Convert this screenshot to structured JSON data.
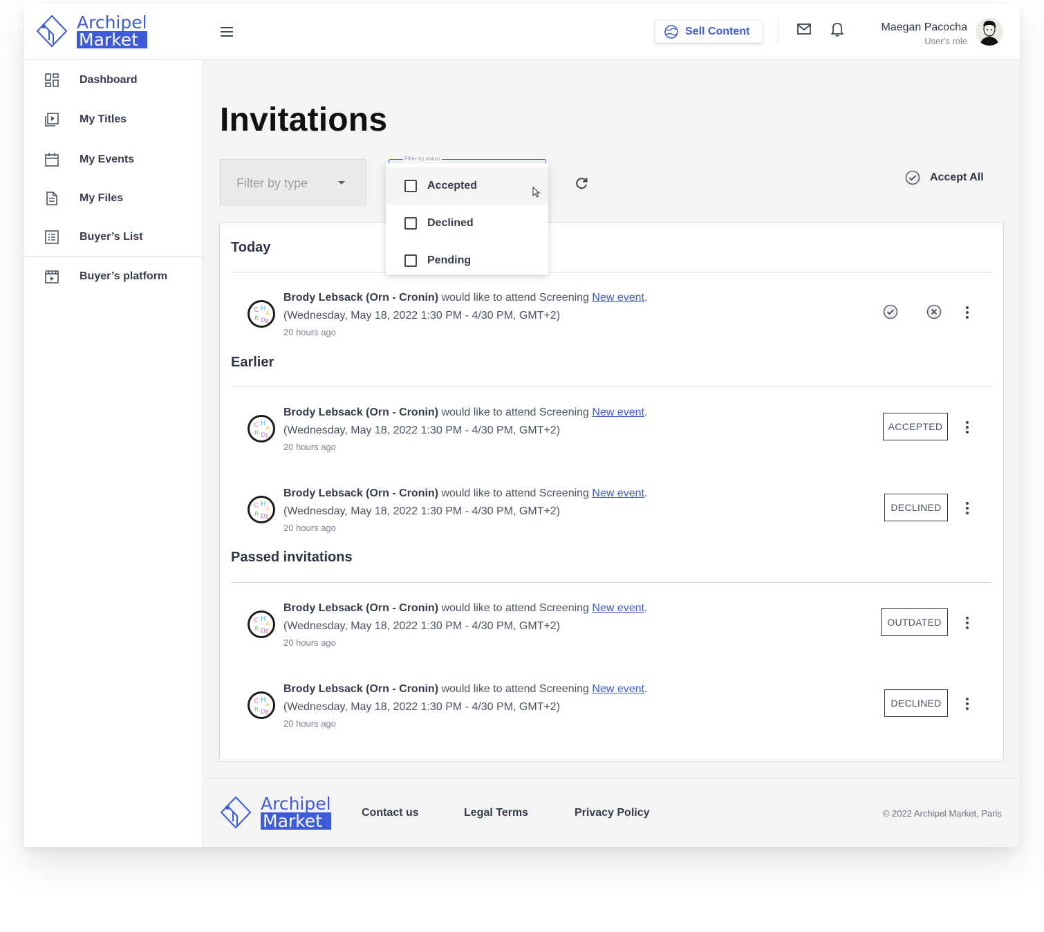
{
  "brand": {
    "line1": "Archipel",
    "line2": "Market",
    "color": "#3d5bd9"
  },
  "header": {
    "menu_icon": "hamburger-icon",
    "sell_label": "Sell Content",
    "mail_icon": "mail-icon",
    "bell_icon": "bell-icon",
    "user_name": "Maegan Pacocha",
    "user_role": "User's role"
  },
  "sidebar": {
    "items": [
      {
        "label": "Dashboard",
        "icon": "dashboard-icon"
      },
      {
        "label": "My Titles",
        "icon": "video-library-icon"
      },
      {
        "label": "My Events",
        "icon": "calendar-icon"
      },
      {
        "label": "My Files",
        "icon": "file-icon"
      },
      {
        "label": "Buyer’s List",
        "icon": "list-icon"
      },
      {
        "label": "Buyer’s platform",
        "icon": "clapperboard-icon"
      }
    ]
  },
  "main": {
    "title": "Invitations",
    "filter_type_placeholder": "Filter by type",
    "filter_status_label": "Filter by status",
    "status_options": [
      "Accepted",
      "Declined",
      "Pending"
    ],
    "accept_all_label": "Accept All"
  },
  "sections": [
    {
      "title": "Today"
    },
    {
      "title": "Earlier"
    },
    {
      "title": "Passed invitations"
    }
  ],
  "invitation_text": {
    "sender": "Brody Lebsack (Orn - Cronin)",
    "middle": " would like to attend Screening ",
    "event": "New event",
    "period": ".",
    "date": "(Wednesday, May 18, 2022 1:30 PM - 4/30 PM, GMT+2)",
    "time_ago": "20 hours ago"
  },
  "invitations": [
    {
      "status": ""
    },
    {
      "status": "ACCEPTED"
    },
    {
      "status": "DECLINED"
    },
    {
      "status": "OUTDATED"
    },
    {
      "status": "DECLINED"
    }
  ],
  "footer": {
    "links": [
      "Contact us",
      "Legal Terms",
      "Privacy Policy"
    ],
    "copyright": "© 2022 Archipel Market, Paris"
  }
}
